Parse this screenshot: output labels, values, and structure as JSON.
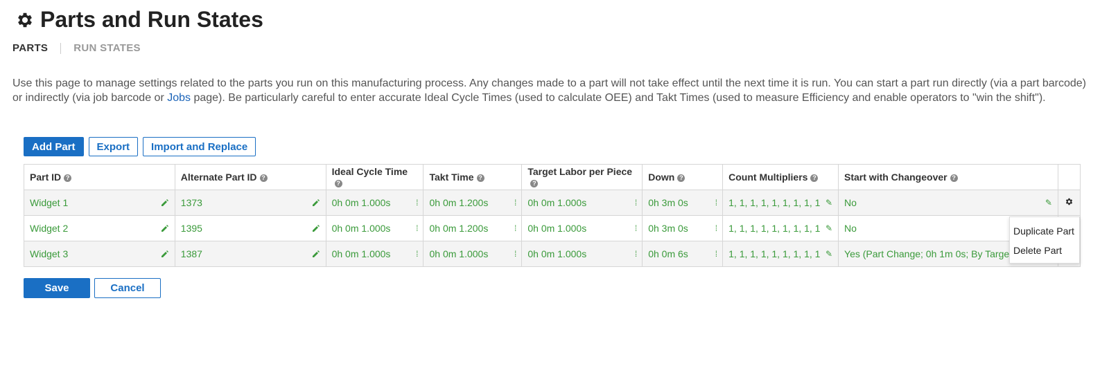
{
  "page": {
    "title": "Parts and Run States",
    "title_icon": "gear-icon"
  },
  "tabs": [
    {
      "label": "PARTS",
      "active": true
    },
    {
      "label": "RUN STATES",
      "active": false
    }
  ],
  "description": {
    "before_link": "Use this page to manage settings related to the parts you run on this manufacturing process. Any changes made to a part will not take effect until the next time it is run. You can start a part run directly (via a part barcode) or indirectly (via job barcode or ",
    "link": "Jobs",
    "after_link": " page). Be particularly careful to enter accurate Ideal Cycle Times (used to calculate OEE) and Takt Times (used to measure Efficiency and enable operators to \"win the shift\")."
  },
  "toolbar": {
    "add_part": "Add Part",
    "export": "Export",
    "import_replace": "Import and Replace"
  },
  "table": {
    "headers": [
      "Part ID",
      "Alternate Part ID",
      "Ideal Cycle Time",
      "Takt Time",
      "Target Labor per Piece",
      "Down",
      "Count Multipliers",
      "Start with Changeover"
    ],
    "rows": [
      {
        "part_id": "Widget 1",
        "alt_id": "1373",
        "ideal": "0h 0m 1.000s",
        "takt": "0h 0m 1.200s",
        "labor": "0h 0m 1.000s",
        "down": "0h 3m 0s",
        "multipliers": "1, 1, 1, 1, 1, 1, 1, 1, 1",
        "changeover": "No"
      },
      {
        "part_id": "Widget 2",
        "alt_id": "1395",
        "ideal": "0h 0m 1.000s",
        "takt": "0h 0m 1.200s",
        "labor": "0h 0m 1.000s",
        "down": "0h 3m 0s",
        "multipliers": "1, 1, 1, 1, 1, 1, 1, 1, 1",
        "changeover": "No"
      },
      {
        "part_id": "Widget 3",
        "alt_id": "1387",
        "ideal": "0h 0m 1.000s",
        "takt": "0h 0m 1.000s",
        "labor": "0h 0m 1.000s",
        "down": "0h 0m 6s",
        "multipliers": "1, 1, 1, 1, 1, 1, 1, 1, 1",
        "changeover": "Yes (Part Change; 0h 1m 0s; By Target Ti"
      }
    ]
  },
  "context_menu": {
    "items": [
      "Duplicate Part",
      "Delete Part"
    ]
  },
  "footer": {
    "save": "Save",
    "cancel": "Cancel"
  },
  "colors": {
    "primary": "#1a6fc4",
    "value_green": "#3a9a3a",
    "link_blue": "#1a63b8"
  }
}
